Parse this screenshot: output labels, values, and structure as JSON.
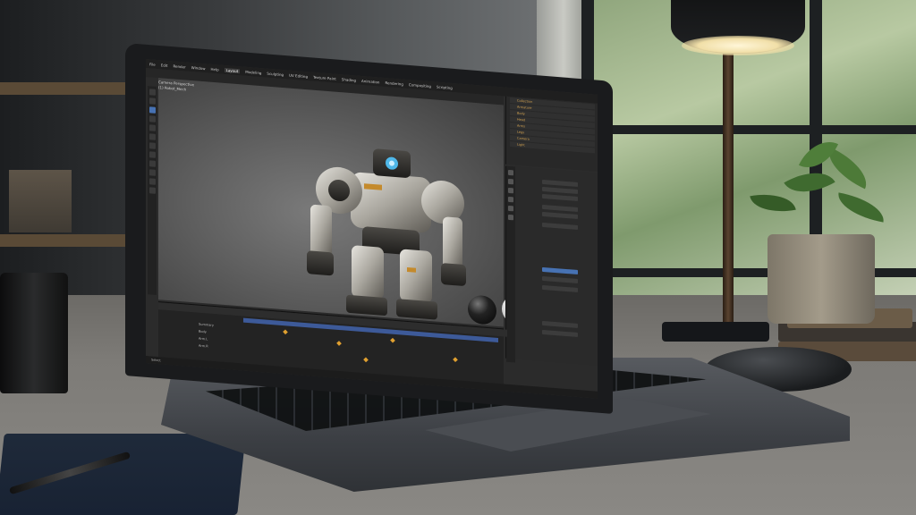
{
  "screen_ui": {
    "app": "Blender",
    "menu": [
      "File",
      "Edit",
      "Render",
      "Window",
      "Help",
      "Layout",
      "Modeling",
      "Sculpting",
      "UV Editing",
      "Texture Paint",
      "Shading",
      "Animation",
      "Rendering",
      "Compositing",
      "Scripting"
    ],
    "active_workspace": "Layout",
    "viewport_label": [
      "Camera Perspective",
      "(1) Robot_Mech"
    ],
    "outliner_items": [
      "Collection",
      "Armature",
      "Body",
      "Head",
      "Arms",
      "Legs",
      "Camera",
      "Light"
    ],
    "timeline_rows": [
      "Summary",
      "Body",
      "Arm.L",
      "Arm.R"
    ],
    "status_text": "Select"
  },
  "colors": {
    "ui_accent": "#4772b3",
    "keyframe": "#e0a030",
    "timeline_range": "#3d5a99"
  },
  "objects": [
    "laptop",
    "desk-lamp",
    "potted-plant",
    "wireless-mouse",
    "coffee-mug",
    "notebook",
    "pen",
    "window"
  ]
}
